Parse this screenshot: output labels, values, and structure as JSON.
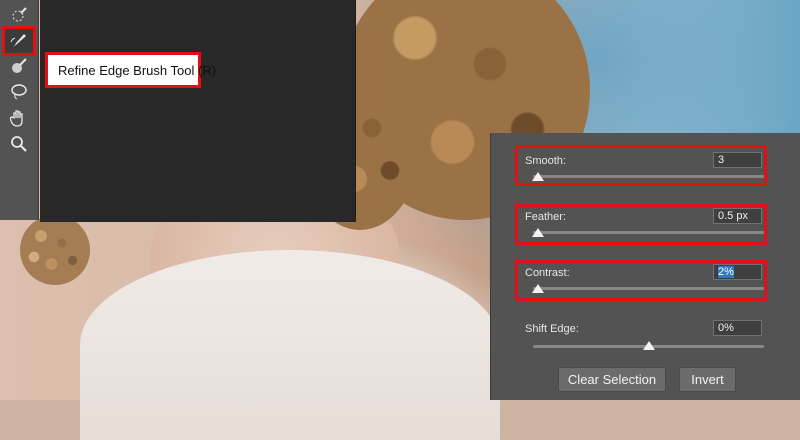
{
  "toolbar": {
    "tools": [
      {
        "icon": "quick-selection-icon",
        "glyph": "⟡"
      },
      {
        "icon": "refine-edge-brush-icon",
        "glyph": "✎"
      },
      {
        "icon": "brush-icon",
        "glyph": "🖌"
      },
      {
        "icon": "lasso-icon",
        "glyph": "◯"
      },
      {
        "icon": "hand-icon",
        "glyph": "✋"
      },
      {
        "icon": "zoom-icon",
        "glyph": "🔍"
      }
    ],
    "selected_tool": "refine-edge-brush-icon"
  },
  "tooltip": {
    "text": "Refine Edge Brush Tool (R)"
  },
  "properties": {
    "smooth": {
      "label": "Smooth:",
      "value": "3",
      "slider_fraction": 0.02
    },
    "feather": {
      "label": "Feather:",
      "value": "0.5 px",
      "slider_fraction": 0.02
    },
    "contrast": {
      "label": "Contrast:",
      "value": "2%",
      "slider_fraction": 0.02
    },
    "shift_edge": {
      "label": "Shift Edge:",
      "value": "0%",
      "slider_fraction": 0.5
    }
  },
  "buttons": {
    "clear_selection": "Clear Selection",
    "invert": "Invert"
  },
  "colors": {
    "highlight": "#e01015",
    "panel_bg": "#535353",
    "flyout_bg": "#282828",
    "selection_blue": "#2f76d2"
  }
}
